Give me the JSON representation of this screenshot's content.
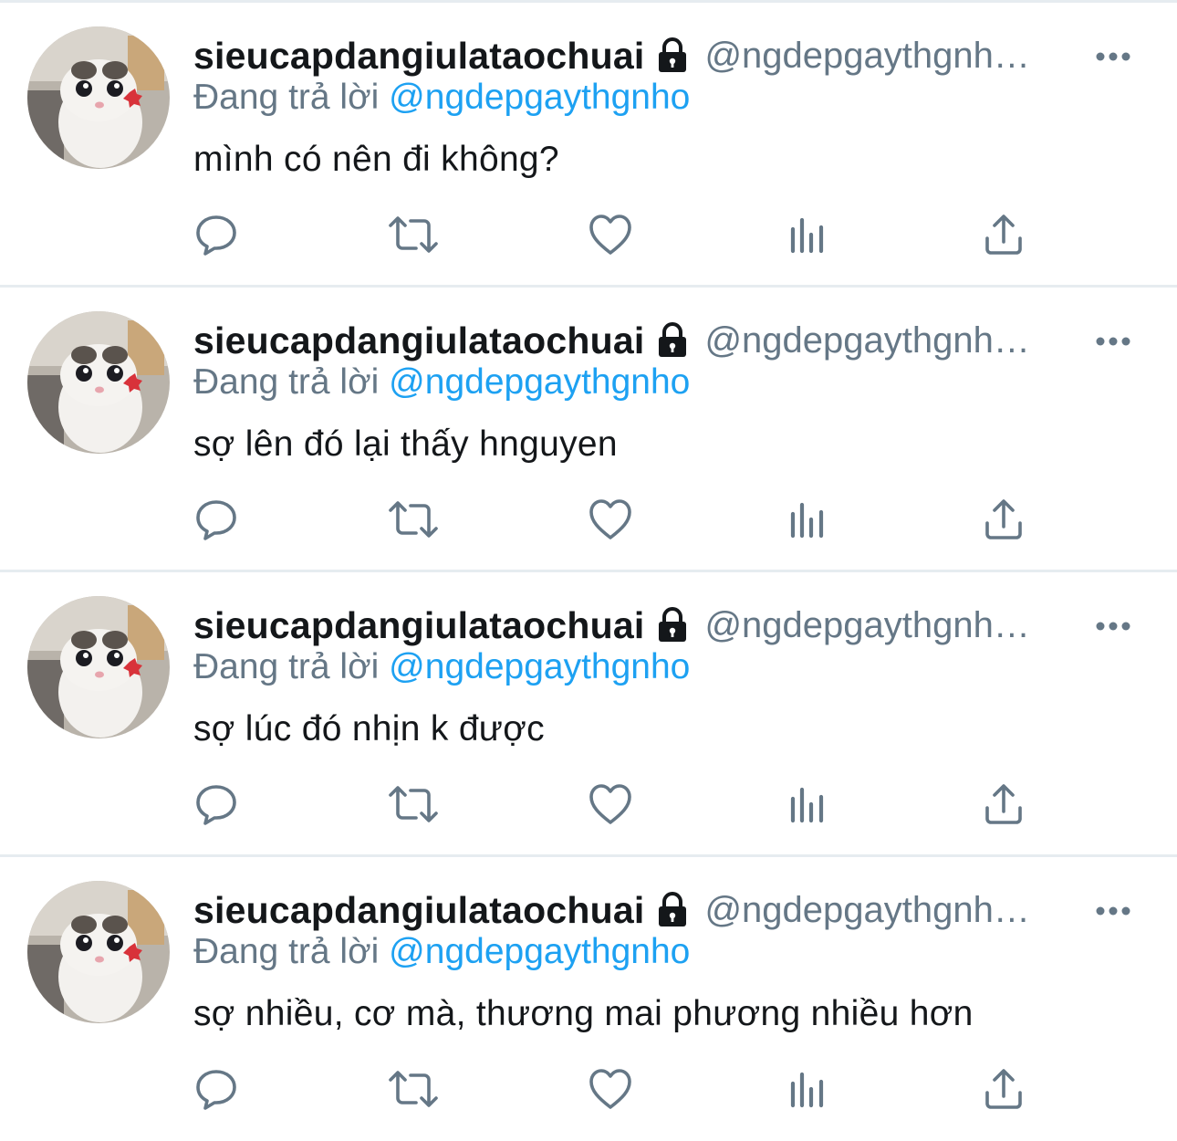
{
  "colors": {
    "text": "#14171a",
    "secondary": "#657786",
    "accent": "#1da1f2",
    "divider": "#e6ecf0",
    "icon": "#657786"
  },
  "tweets": [
    {
      "display_name": "sieucapdangiulataochuai",
      "handle": "@ngdepgaythgnh…",
      "replying_prefix": "Đang trả lời",
      "replying_to": "@ngdepgaythgnho",
      "text": "mình có nên đi không?",
      "icons": [
        "lock-icon",
        "more-icon",
        "reply-icon",
        "retweet-icon",
        "like-icon",
        "analytics-icon",
        "share-icon"
      ]
    },
    {
      "display_name": "sieucapdangiulataochuai",
      "handle": "@ngdepgaythgnh…",
      "replying_prefix": "Đang trả lời",
      "replying_to": "@ngdepgaythgnho",
      "text": "sợ lên đó lại thấy hnguyen",
      "icons": [
        "lock-icon",
        "more-icon",
        "reply-icon",
        "retweet-icon",
        "like-icon",
        "analytics-icon",
        "share-icon"
      ]
    },
    {
      "display_name": "sieucapdangiulataochuai",
      "handle": "@ngdepgaythgnh…",
      "replying_prefix": "Đang trả lời",
      "replying_to": "@ngdepgaythgnho",
      "text": "sợ lúc đó nhịn k được",
      "icons": [
        "lock-icon",
        "more-icon",
        "reply-icon",
        "retweet-icon",
        "like-icon",
        "analytics-icon",
        "share-icon"
      ]
    },
    {
      "display_name": "sieucapdangiulataochuai",
      "handle": "@ngdepgaythgnh…",
      "replying_prefix": "Đang trả lời",
      "replying_to": "@ngdepgaythgnho",
      "text": "sợ nhiều, cơ mà, thương mai phương nhiều hơn",
      "icons": [
        "lock-icon",
        "more-icon",
        "reply-icon",
        "retweet-icon",
        "like-icon",
        "analytics-icon",
        "share-icon"
      ]
    }
  ]
}
